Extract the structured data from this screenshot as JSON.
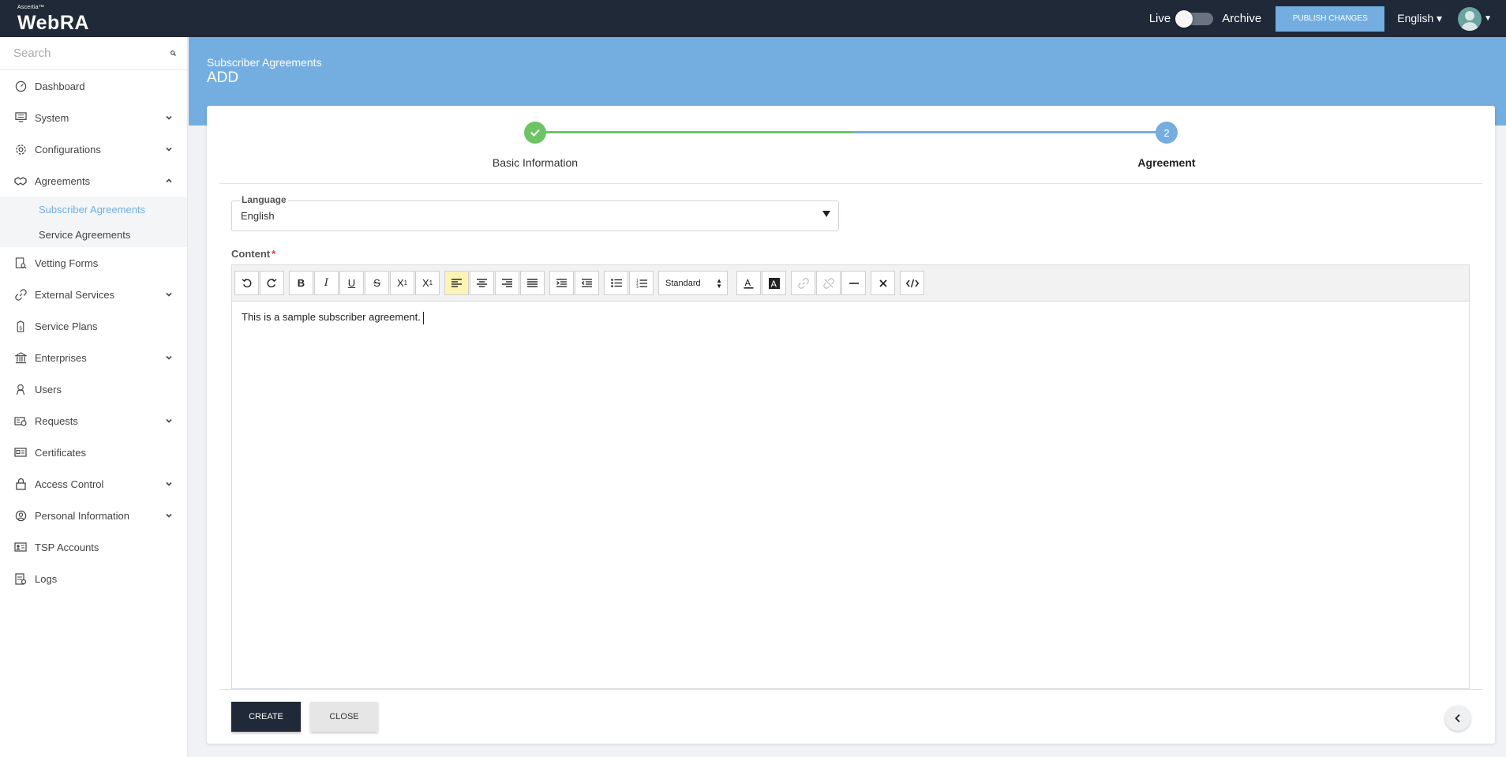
{
  "app": {
    "brand_small": "Ascertia™",
    "brand": "WebRA"
  },
  "topbar": {
    "live_label": "Live",
    "archive_label": "Archive",
    "publish_label": "PUBLISH CHANGES",
    "language": "English ▾"
  },
  "sidebar": {
    "search_placeholder": "Search",
    "items": [
      {
        "label": "Dashboard"
      },
      {
        "label": "System"
      },
      {
        "label": "Configurations"
      },
      {
        "label": "Agreements"
      },
      {
        "label": "Vetting Forms"
      },
      {
        "label": "External Services"
      },
      {
        "label": "Service Plans"
      },
      {
        "label": "Enterprises"
      },
      {
        "label": "Users"
      },
      {
        "label": "Requests"
      },
      {
        "label": "Certificates"
      },
      {
        "label": "Access Control"
      },
      {
        "label": "Personal Information"
      },
      {
        "label": "TSP Accounts"
      },
      {
        "label": "Logs"
      }
    ],
    "sub_items": [
      {
        "label": "Subscriber Agreements"
      },
      {
        "label": "Service Agreements"
      }
    ]
  },
  "header": {
    "breadcrumb": "Subscriber Agreements",
    "title": "ADD"
  },
  "stepper": {
    "step1_label": "Basic Information",
    "step2_number": "2",
    "step2_label": "Agreement"
  },
  "form": {
    "language_label": "Language",
    "language_value": "English",
    "content_label": "Content",
    "required_mark": "*",
    "format_select": "Standard",
    "content_text": "This is a sample subscriber agreement."
  },
  "actions": {
    "create_label": "CREATE",
    "close_label": "CLOSE"
  },
  "colors": {
    "accent": "#74aee0",
    "success": "#6cc465",
    "dark": "#1f2937"
  }
}
